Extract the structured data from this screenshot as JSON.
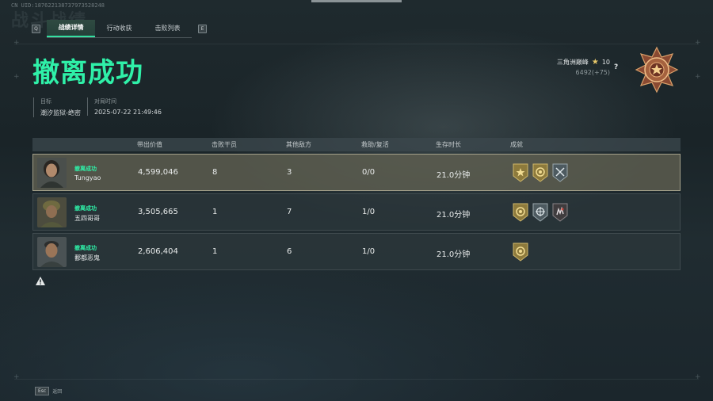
{
  "uid_text": "CN UID:187622138737973528248",
  "bg_title": "战斗战绩",
  "tabs": {
    "prev_key": "Q",
    "next_key": "E",
    "items": [
      {
        "label": "战绩详情",
        "active": true
      },
      {
        "label": "行动收获",
        "active": false
      },
      {
        "label": "击败列表",
        "active": false
      }
    ]
  },
  "result_title": "撤离成功",
  "meta": {
    "target_label": "目标",
    "target_value": "潮汐监狱-绝密",
    "time_label": "对局时间",
    "time_value": "2025-07-22 21:49:46"
  },
  "rank": {
    "name": "三角洲巅峰",
    "stars": "10",
    "score": "6492(+75)",
    "help": "?"
  },
  "table": {
    "headers": [
      "带出价值",
      "击败干员",
      "其他敌方",
      "救助/复活",
      "生存时长",
      "成就"
    ],
    "rows": [
      {
        "status": "撤离成功",
        "name": "Tungyao",
        "value": "4,599,046",
        "kills": "8",
        "other": "3",
        "revive": "0/0",
        "time": "21.0分钟",
        "achievements": [
          "gold-star-shield-icon",
          "gold-ring-shield-icon",
          "steel-swords-shield-icon"
        ]
      },
      {
        "status": "撤离成功",
        "name": "五四哥哥",
        "value": "3,505,665",
        "kills": "1",
        "other": "7",
        "revive": "1/0",
        "time": "21.0分钟",
        "achievements": [
          "gold-ring-shield-icon",
          "steel-emblem-shield-icon",
          "dark-hand-shield-icon"
        ]
      },
      {
        "status": "撤离成功",
        "name": "鄱都恶鬼",
        "value": "2,606,404",
        "kills": "1",
        "other": "6",
        "revive": "1/0",
        "time": "21.0分钟",
        "achievements": [
          "gold-ring-shield-icon"
        ]
      }
    ]
  },
  "footer": {
    "esc_key": "Esc",
    "esc_label": "返回"
  },
  "colors": {
    "accent": "#2ff0a8",
    "highlight_row": "#62624f"
  }
}
